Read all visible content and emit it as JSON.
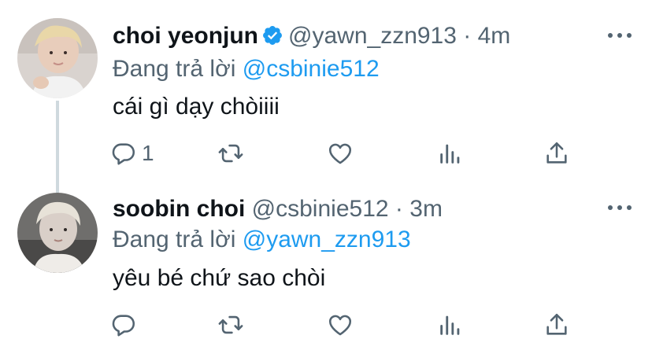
{
  "tweets": [
    {
      "name": "choi yeonjun",
      "verified": true,
      "handle": "@yawn_zzn913",
      "separator": "·",
      "time": "4m",
      "reply_prefix": "Đang trả lời",
      "reply_to": "@csbinie512",
      "text": "cái gì dạy chòiiii",
      "reply_count": "1"
    },
    {
      "name": "soobin choi",
      "verified": false,
      "handle": "@csbinie512",
      "separator": "·",
      "time": "3m",
      "reply_prefix": "Đang trả lời",
      "reply_to": "@yawn_zzn913",
      "text": "yêu bé chứ sao chòi",
      "reply_count": ""
    }
  ],
  "colors": {
    "link": "#1d9bf0",
    "muted": "#536471",
    "verified": "#1d9bf0",
    "thread_line": "#cfd9de"
  },
  "icons": [
    "reply-icon",
    "retweet-icon",
    "like-icon",
    "stats-icon",
    "share-icon",
    "more-icon",
    "verified-icon"
  ]
}
